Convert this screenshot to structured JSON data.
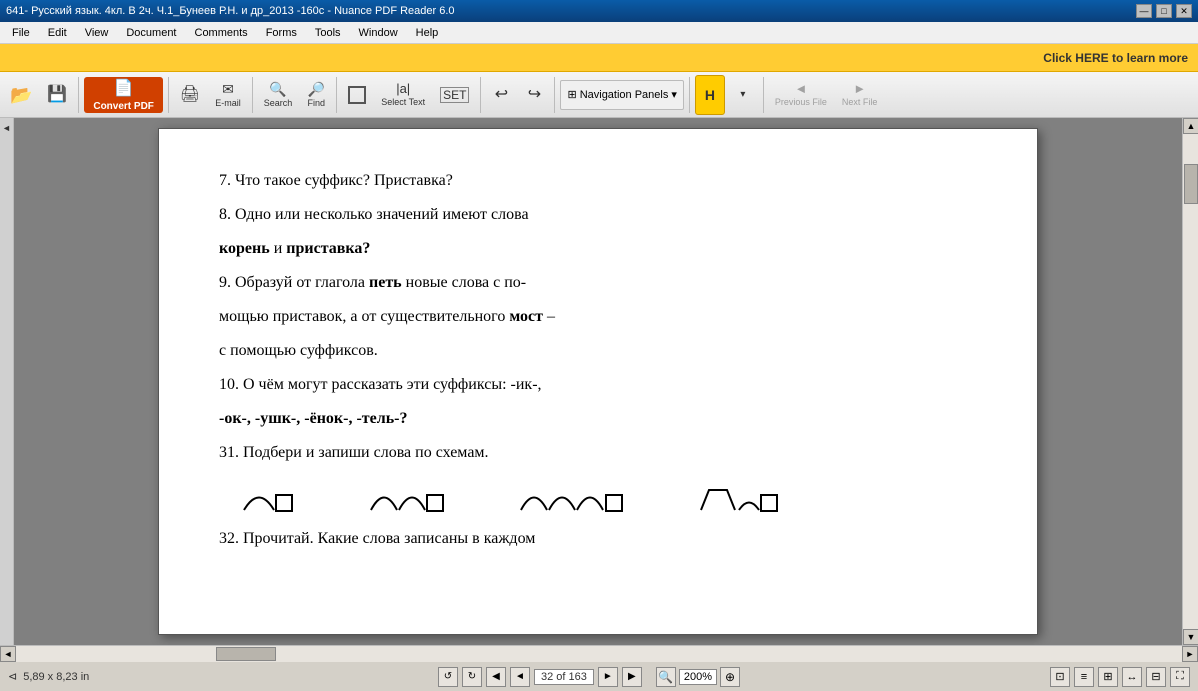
{
  "titlebar": {
    "title": "641- Русский язык. 4кл. В 2ч. Ч.1_Бунеев Р.Н. и др_2013 -160c - Nuance PDF Reader 6.0",
    "minimize": "—",
    "maximize": "□",
    "close": "✕"
  },
  "menubar": {
    "items": [
      "File",
      "Edit",
      "View",
      "Document",
      "Comments",
      "Forms",
      "Tools",
      "Window",
      "Help"
    ]
  },
  "adbar": {
    "text": "Click HERE to learn more"
  },
  "toolbar": {
    "buttons": [
      {
        "label": "📂",
        "name": "open"
      },
      {
        "label": "💾",
        "name": "save"
      },
      {
        "label": "Convert PDF",
        "name": "convert-pdf"
      },
      {
        "label": "🖨",
        "name": "print"
      },
      {
        "label": "E-mail",
        "name": "email"
      },
      {
        "label": "Search",
        "name": "search"
      },
      {
        "label": "Find",
        "name": "find"
      },
      {
        "label": "⬜",
        "name": "select-frame"
      },
      {
        "label": "Select Text",
        "name": "select-text"
      },
      {
        "label": "↩",
        "name": "undo"
      },
      {
        "label": "↪",
        "name": "redo"
      },
      {
        "label": "Navigation Panels",
        "name": "nav-panels"
      },
      {
        "label": "H",
        "name": "highlight"
      },
      {
        "label": "Previous File",
        "name": "prev-file"
      },
      {
        "label": "Next File",
        "name": "next-file"
      }
    ]
  },
  "pdf": {
    "content": {
      "line1": "7.  Что такое суффикс? Приставка?",
      "line2": "8.  Одно или несколько значений имеют слова",
      "line3_bold_part1": "корень",
      "line3_text": " и ",
      "line3_bold_part2": "приставка?",
      "line4": "9.  Образуй от глагола ",
      "line4_bold": "петь",
      "line4_cont": " новые слова с по-",
      "line5": "мощью приставок, а от существительного ",
      "line5_bold": "мост",
      "line5_dash": " –",
      "line6": "с помощью суффиксов.",
      "line7": "10.  О чём могут рассказать эти суффиксы: -ик-,",
      "line8": "-ок-,  -ушк-,  -ёнок-,  -тель-?",
      "line9": "31.  Подбери и запиши слова по схемам.",
      "line10_partial": "32.  Прочитай.  Какие  слова  записаны  в  каждом"
    }
  },
  "bottombar": {
    "dimensions": "5,89 x 8,23 in",
    "page_current": "32",
    "page_separator": "of",
    "page_total": "163",
    "zoom": "200%",
    "nav_prev": "◄",
    "nav_next": "►",
    "nav_first": "◀",
    "nav_last": "▶"
  }
}
